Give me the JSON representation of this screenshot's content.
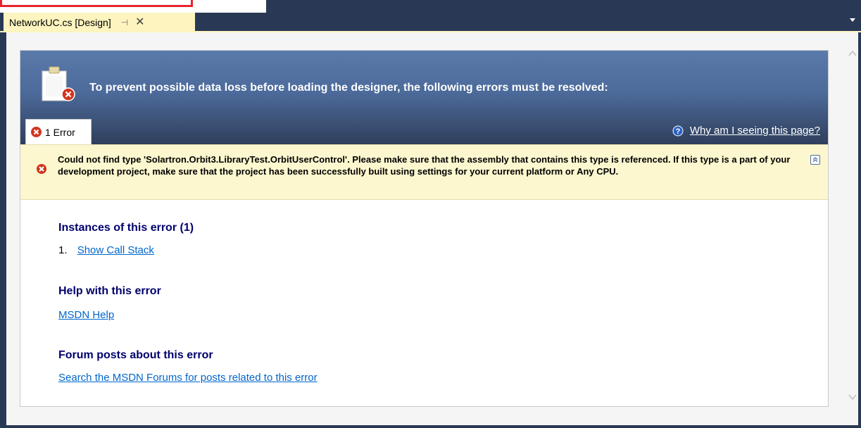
{
  "tab": {
    "title": "NetworkUC.cs [Design]",
    "pin_glyph": "⊣",
    "close_glyph": "✕"
  },
  "banner": {
    "message": "To prevent possible data loss before loading the designer, the following errors must be resolved:",
    "icon": "clipboard-error-icon"
  },
  "errors_tab": {
    "label": "1 Error",
    "icon": "error-icon"
  },
  "why_link": {
    "label": "Why am I seeing this page?",
    "icon": "help-icon"
  },
  "error": {
    "message": "Could not find type 'Solartron.Orbit3.LibraryTest.OrbitUserControl'. Please make sure that the assembly that contains this type is referenced. If this type is a part of your development project, make sure that the project has been successfully built using settings for your current platform or Any CPU."
  },
  "instances": {
    "heading": "Instances of this error (1)",
    "items": [
      {
        "number": "1.",
        "link": "Show Call Stack"
      }
    ]
  },
  "help": {
    "heading": "Help with this error",
    "link": "MSDN Help"
  },
  "forum": {
    "heading": "Forum posts about this error",
    "link": "Search the MSDN Forums for posts related to this error"
  },
  "colors": {
    "tabbar": "#293955",
    "active_tab": "#fdf4bf",
    "banner": "#4c6a9a",
    "error_row": "#fdf7cf",
    "heading": "#00006e",
    "link": "#0066cc",
    "highlight": "#e8232b"
  }
}
